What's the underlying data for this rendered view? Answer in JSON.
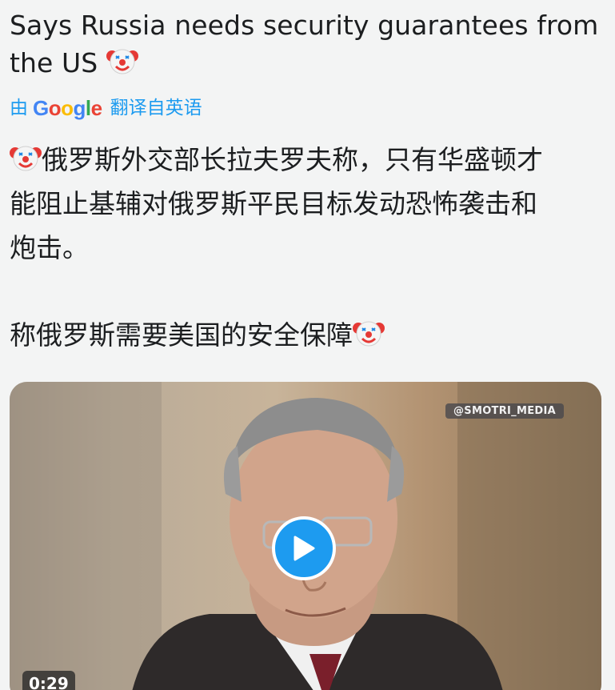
{
  "tweet": {
    "text_line1": "Says Russia needs security guarantees from",
    "text_line2": "the US"
  },
  "translation": {
    "by": "由",
    "provider": "Google",
    "from_label": "翻译自英语",
    "para1_line1": "俄罗斯外交部长拉夫罗夫称，只有华盛顿才",
    "para1_line2": "能阻止基辅对俄罗斯平民目标发动恐怖袭击和",
    "para1_line3": "炮击。",
    "para2": "称俄罗斯需要美国的安全保障"
  },
  "media": {
    "watermark": "@SMOTRI_MEDIA",
    "duration": "0:29"
  },
  "icons": {
    "emoji": "clown-face-icon",
    "play": "play-icon"
  },
  "colors": {
    "accent": "#1d9bf0",
    "background": "#f3f4f4",
    "text": "#1c1e20"
  }
}
